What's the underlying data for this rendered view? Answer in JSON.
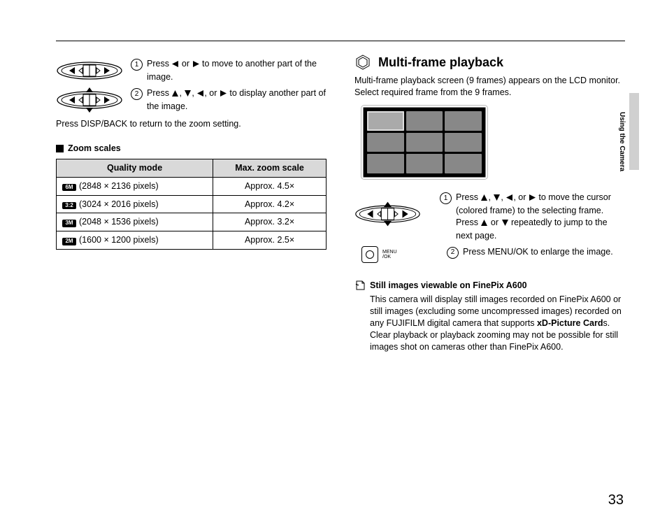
{
  "sidebar": {
    "label": "Using the Camera"
  },
  "page_number": "33",
  "left": {
    "step1": {
      "num": "1",
      "pre": "Press ",
      "post": " to move to another part of the image."
    },
    "step2": {
      "num": "2",
      "pre": "Press ",
      "post": " to display another part of the image."
    },
    "disp_back": "Press DISP/BACK to return to the zoom setting.",
    "zoom_heading": "Zoom scales",
    "table": {
      "h1": "Quality mode",
      "h2": "Max. zoom scale",
      "rows": [
        {
          "badge": "6M",
          "label": "(2848 × 2136 pixels)",
          "zoom": "Approx. 4.5×"
        },
        {
          "badge": "3:2",
          "label": "(3024 × 2016 pixels)",
          "zoom": "Approx. 4.2×"
        },
        {
          "badge": "3M",
          "label": "(2048 × 1536 pixels)",
          "zoom": "Approx. 3.2×"
        },
        {
          "badge": "2M",
          "label": "(1600 × 1200 pixels)",
          "zoom": "Approx. 2.5×"
        }
      ]
    }
  },
  "right": {
    "heading": "Multi-frame playback",
    "intro": "Multi-frame playback screen (9 frames) appears on the LCD monitor. Select required frame from the 9 frames.",
    "step1": {
      "num": "1",
      "pre": "Press ",
      "mid": " to move the cursor (colored frame) to the selecting frame.",
      "line2a": "Press ",
      "line2b": " repeatedly to jump to the next page."
    },
    "step2": {
      "num": "2",
      "text": "Press MENU/OK to enlarge the image."
    },
    "ok_label": "MENU\n/OK",
    "tip_heading": "Still images viewable on FinePix A600",
    "tip_body_a": "This camera will display still images recorded on FinePix A600 or still images (excluding some uncompressed images) recorded on any FUJIFILM digital camera that supports ",
    "tip_bold": "xD-Picture Card",
    "tip_body_b": "s. Clear playback or playback zooming may not be possible for still images shot on cameras other than FinePix A600."
  }
}
